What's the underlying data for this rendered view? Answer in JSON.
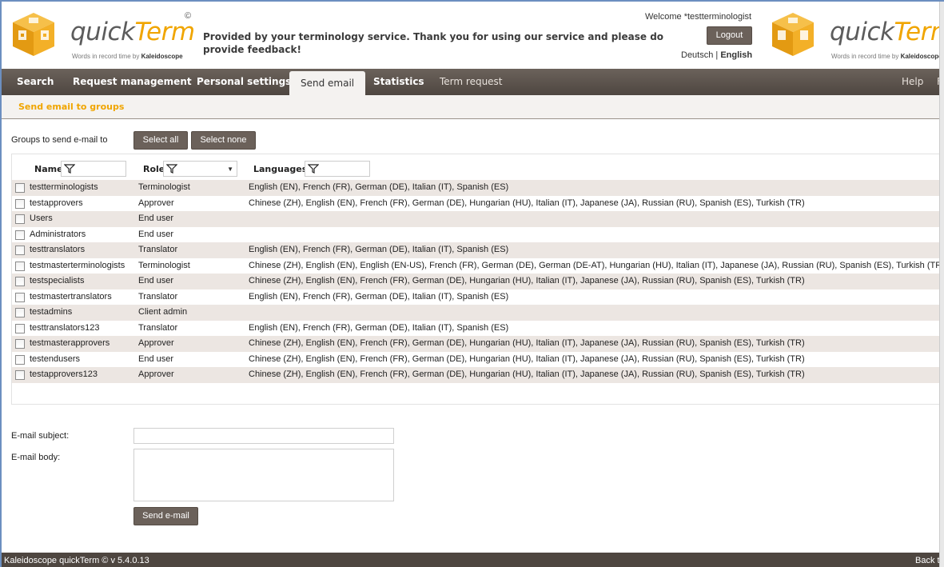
{
  "brand": {
    "name_part1": "quick",
    "name_part2": "Term",
    "copyright_mark": "©",
    "tagline_prefix": "Words in record time by",
    "tagline_company": "Kaleidoscope"
  },
  "header": {
    "message": "Provided by your terminology service. Thank you for using our service and please do provide feedback!",
    "welcome": "Welcome *testterminologist",
    "logout_label": "Logout",
    "lang_other": "Deutsch",
    "lang_sep": "|",
    "lang_current": "English"
  },
  "nav": {
    "items": [
      "Search",
      "Request management",
      "Personal settings",
      "Send email",
      "Statistics",
      "Term request"
    ],
    "active": "Send email",
    "help": "Help",
    "cut_label": "F"
  },
  "subtab": {
    "label": "Send email to groups"
  },
  "groups": {
    "label": "Groups to send e-mail to",
    "select_all": "Select all",
    "select_none": "Select none",
    "columns": {
      "name": "Name",
      "role": "Role",
      "languages": "Languages"
    },
    "rows": [
      {
        "name": "testterminologists",
        "role": "Terminologist",
        "languages": "English (EN), French (FR), German (DE), Italian (IT), Spanish (ES)"
      },
      {
        "name": "testapprovers",
        "role": "Approver",
        "languages": "Chinese (ZH), English (EN), French (FR), German (DE), Hungarian (HU), Italian (IT), Japanese (JA), Russian (RU), Spanish (ES), Turkish (TR)"
      },
      {
        "name": "Users",
        "role": "End user",
        "languages": ""
      },
      {
        "name": "Administrators",
        "role": "End user",
        "languages": ""
      },
      {
        "name": "testtranslators",
        "role": "Translator",
        "languages": "English (EN), French (FR), German (DE), Italian (IT), Spanish (ES)"
      },
      {
        "name": "testmasterterminologists",
        "role": "Terminologist",
        "languages": "Chinese (ZH), English (EN), English (EN-US), French (FR), German (DE), German (DE-AT), Hungarian (HU), Italian (IT), Japanese (JA), Russian (RU), Spanish (ES), Turkish (TR)"
      },
      {
        "name": "testspecialists",
        "role": "End user",
        "languages": "Chinese (ZH), English (EN), French (FR), German (DE), Hungarian (HU), Italian (IT), Japanese (JA), Russian (RU), Spanish (ES), Turkish (TR)"
      },
      {
        "name": "testmastertranslators",
        "role": "Translator",
        "languages": "English (EN), French (FR), German (DE), Italian (IT), Spanish (ES)"
      },
      {
        "name": "testadmins",
        "role": "Client admin",
        "languages": ""
      },
      {
        "name": "testtranslators123",
        "role": "Translator",
        "languages": "English (EN), French (FR), German (DE), Italian (IT), Spanish (ES)"
      },
      {
        "name": "testmasterapprovers",
        "role": "Approver",
        "languages": "Chinese (ZH), English (EN), French (FR), German (DE), Hungarian (HU), Italian (IT), Japanese (JA), Russian (RU), Spanish (ES), Turkish (TR)"
      },
      {
        "name": "testendusers",
        "role": "End user",
        "languages": "Chinese (ZH), English (EN), French (FR), German (DE), Hungarian (HU), Italian (IT), Japanese (JA), Russian (RU), Spanish (ES), Turkish (TR)"
      },
      {
        "name": "testapprovers123",
        "role": "Approver",
        "languages": "Chinese (ZH), English (EN), French (FR), German (DE), Hungarian (HU), Italian (IT), Japanese (JA), Russian (RU), Spanish (ES), Turkish (TR)"
      }
    ]
  },
  "email": {
    "subject_label": "E-mail subject:",
    "subject_value": "",
    "body_label": "E-mail body:",
    "body_value": "",
    "send_label": "Send e-mail"
  },
  "footer": {
    "version": "Kaleidoscope quickTerm © v 5.4.0.13",
    "back": "Back t"
  },
  "colors": {
    "nav_bg": "#5c534d",
    "accent": "#f0a500",
    "row_alt": "#ece6e2",
    "button": "#6b615a"
  },
  "icons": [
    "cube-logo-icon",
    "filter-icon",
    "chevron-down-icon",
    "checkbox-icon",
    "resize-grip-icon"
  ]
}
